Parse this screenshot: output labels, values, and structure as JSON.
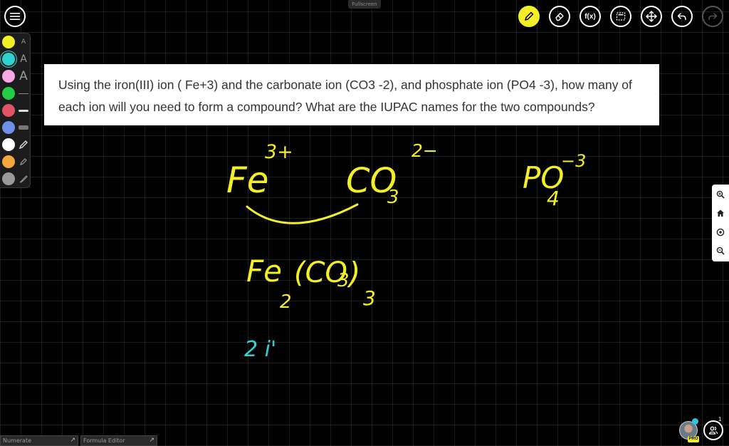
{
  "top": {
    "fullscreen_label": "Fullscreen"
  },
  "toolbar": {
    "tools": [
      {
        "name": "pen-tool",
        "icon": "pencil-icon",
        "active": true
      },
      {
        "name": "eraser-tool",
        "icon": "eraser-icon"
      },
      {
        "name": "formula-tool",
        "icon": "function-icon",
        "label": "f(x)"
      },
      {
        "name": "select-tool",
        "icon": "selection-icon"
      },
      {
        "name": "move-tool",
        "icon": "move-arrows-icon"
      },
      {
        "name": "undo-button",
        "icon": "undo-icon"
      },
      {
        "name": "redo-button",
        "icon": "redo-icon",
        "disabled": true
      }
    ]
  },
  "palette": {
    "colors": [
      "#f4ee26",
      "#2fd1d1",
      "#f7a6e8",
      "#22cc44",
      "#e05565",
      "#6f8fe8",
      "#ffffff",
      "#f2a640",
      "#9a9a9a"
    ],
    "tools": [
      {
        "icon": "text-small-icon",
        "label": "A"
      },
      {
        "icon": "text-icon",
        "label": "A"
      },
      {
        "icon": "text-large-icon",
        "label": "A"
      },
      {
        "icon": "thin-line-icon"
      },
      {
        "icon": "medium-line-icon"
      },
      {
        "icon": "thick-line-icon"
      },
      {
        "icon": "pen-icon"
      },
      {
        "icon": "highlighter-icon"
      },
      {
        "icon": "brush-icon"
      }
    ]
  },
  "question": {
    "text": "Using the iron(III) ion ( Fe+3) and the carbonate ion (CO3 -2), and phosphate ion (PO4 -3), how many of each ion will you need to form a compound? What are the IUPAC names for the two compounds?"
  },
  "handwriting": {
    "fe": "Fe",
    "fe_charge": "3+",
    "co3": "CO",
    "co3_sub": "3",
    "co3_charge": "2−",
    "po4": "PO",
    "po4_sub": "4",
    "po4_charge": "−3",
    "formula_fe": "Fe",
    "formula_fe_sub": "2",
    "formula_group": "(CO",
    "formula_inner_sub": "3",
    "formula_close": ")",
    "formula_outer_sub": "3",
    "note": "2 i'",
    "ink_color": "#f4ee26",
    "note_color": "#2fd1d1"
  },
  "zoom_controls": [
    {
      "icon": "zoom-in-icon"
    },
    {
      "icon": "home-icon"
    },
    {
      "icon": "target-icon"
    },
    {
      "icon": "zoom-out-icon"
    }
  ],
  "bottom_tabs": [
    {
      "label": "Numerate"
    },
    {
      "label": "Formula Editor"
    }
  ],
  "user": {
    "badge": "PRO",
    "participants": "1"
  }
}
